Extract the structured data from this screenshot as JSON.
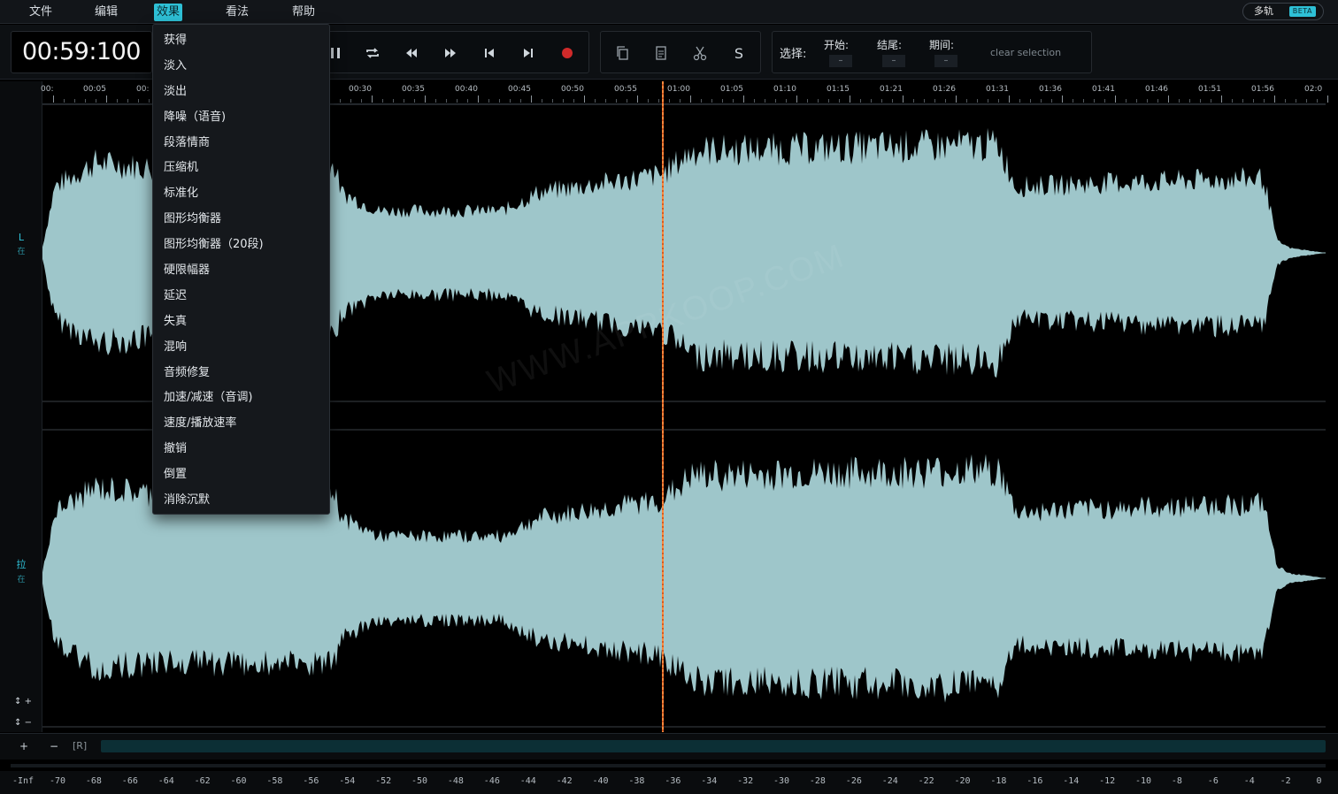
{
  "menubar": {
    "items": [
      "文件",
      "编辑",
      "效果",
      "看法",
      "帮助"
    ],
    "active_index": 2,
    "multitrack_label": "多轨",
    "beta_label": "BETA"
  },
  "toolbar": {
    "time": "00:59:100",
    "stop_label": "S",
    "selection_label": "选择:",
    "start_label": "开始:",
    "end_label": "结尾:",
    "duration_label": "期间:",
    "start_value": "–",
    "end_value": "–",
    "duration_value": "–",
    "clear_selection": "clear selection"
  },
  "effects_menu": {
    "items": [
      "获得",
      "淡入",
      "淡出",
      "降噪（语音)",
      "段落情商",
      "压缩机",
      "标准化",
      "图形均衡器",
      "图形均衡器（20段)",
      "硬限幅器",
      "延迟",
      "失真",
      "混响",
      "音频修复",
      "加速/减速（音调)",
      "速度/播放速率",
      "撤销",
      "倒置",
      "消除沉默"
    ]
  },
  "ruler": {
    "labels": [
      "00:",
      "00:05",
      "00:",
      "00:30",
      "00:35",
      "00:40",
      "00:45",
      "00:50",
      "00:55",
      "01:00",
      "01:05",
      "01:10",
      "01:15",
      "01:21",
      "01:26",
      "01:31",
      "01:36",
      "01:41",
      "01:46",
      "01:51",
      "01:56",
      "02:0"
    ]
  },
  "channels": {
    "left": {
      "label": "L",
      "sublabel": "在"
    },
    "right": {
      "label": "拉",
      "sublabel": "在"
    }
  },
  "zoom": {
    "in": "↕ +",
    "out": "↕ −"
  },
  "bottom": {
    "plus": "+",
    "minus": "−",
    "region": "[R]"
  },
  "meter": {
    "labels": [
      "-Inf",
      "-70",
      "-68",
      "-66",
      "-64",
      "-62",
      "-60",
      "-58",
      "-56",
      "-54",
      "-52",
      "-50",
      "-48",
      "-46",
      "-44",
      "-42",
      "-40",
      "-38",
      "-36",
      "-34",
      "-32",
      "-30",
      "-28",
      "-26",
      "-24",
      "-22",
      "-20",
      "-18",
      "-16",
      "-14",
      "-12",
      "-10",
      "-8",
      "-6",
      "-4",
      "-2",
      "0"
    ]
  },
  "watermark": "WWW.APPKOOP.COM",
  "colors": {
    "accent": "#2ec0d6",
    "waveform": "#9ec6ca",
    "playhead": "#ff8a3d",
    "record": "#d02a2a"
  }
}
